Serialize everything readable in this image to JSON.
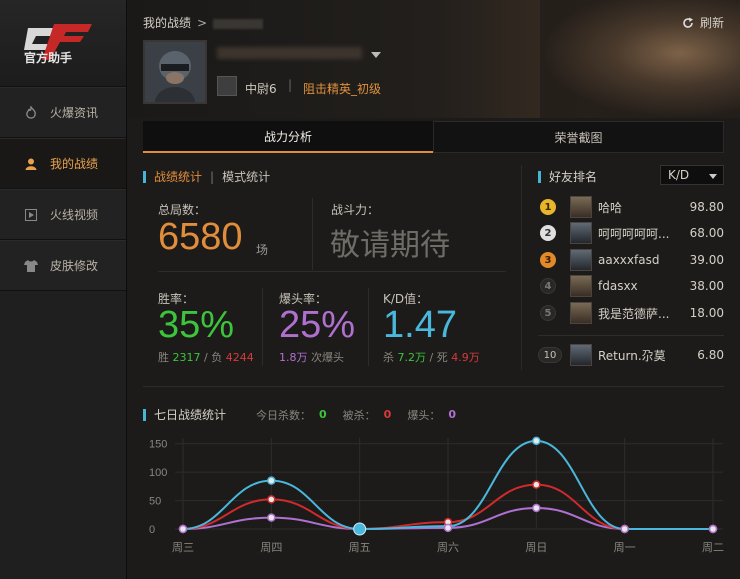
{
  "sidebar": {
    "logo_text": "官方助手",
    "items": [
      {
        "label": "火爆资讯",
        "icon": "flame-icon"
      },
      {
        "label": "我的战绩",
        "icon": "user-icon",
        "active": true
      },
      {
        "label": "火线视频",
        "icon": "play-icon"
      },
      {
        "label": "皮肤修改",
        "icon": "shirt-icon"
      }
    ]
  },
  "header": {
    "breadcrumb_root": "我的战绩",
    "breadcrumb_sep": ">",
    "refresh_label": "刷新",
    "rank": "中尉6",
    "title_badge": "阻击精英_初级"
  },
  "tabs": [
    "战力分析",
    "荣誉截图"
  ],
  "stats": {
    "tab_active": "战绩统计",
    "tab_divider": "|",
    "tab_other": "模式统计",
    "total_label": "总局数：",
    "total_value": "6580",
    "total_unit": "场",
    "power_label": "战斗力：",
    "power_value": "敬请期待",
    "win_label": "胜率：",
    "win_value": "35%",
    "win_prefix": "胜",
    "win_count": "2317",
    "loss_prefix": " / 负",
    "loss_count": "4244",
    "hs_label": "爆头率：",
    "hs_value": "25%",
    "hs_count": "1.8万",
    "hs_suffix": " 次爆头",
    "kd_label": "K/D值：",
    "kd_value": "1.47",
    "kill_prefix": "杀",
    "kill_count": "7.2万",
    "death_prefix": " / 死",
    "death_count": "4.9万"
  },
  "friends": {
    "title": "好友排名",
    "sort_option": "K/D",
    "list": [
      {
        "rank": "1",
        "name": "哈哈",
        "value": "98.80"
      },
      {
        "rank": "2",
        "name": "呵呵呵呵呵...",
        "value": "68.00"
      },
      {
        "rank": "3",
        "name": "aaxxxfasd",
        "value": "39.00"
      },
      {
        "rank": "4",
        "name": "fdasxx",
        "value": "38.00"
      },
      {
        "rank": "5",
        "name": "我是范德萨...",
        "value": "18.00"
      }
    ],
    "self": {
      "rank": "10",
      "name": "Return.尕莫",
      "value": "6.80"
    }
  },
  "seven_day": {
    "title": "七日战绩统计",
    "today_kills_label": "今日杀数：",
    "today_kills": "0",
    "killed_label": "被杀：",
    "killed": "0",
    "headshot_label": "爆头：",
    "headshot": "0"
  },
  "chart_data": {
    "type": "line",
    "categories": [
      "周三",
      "周四",
      "周五",
      "周六",
      "周日",
      "周一",
      "周二"
    ],
    "y_ticks": [
      "0",
      "50",
      "100",
      "150"
    ],
    "ylim": [
      0,
      160
    ],
    "grid": true,
    "series": [
      {
        "color": "#4ab8dc",
        "values": [
          0,
          85,
          0,
          5,
          155,
          0,
          0
        ]
      },
      {
        "color": "#d02a2a",
        "values": [
          0,
          52,
          0,
          12,
          78,
          0,
          0
        ]
      },
      {
        "color": "#b070d0",
        "values": [
          0,
          20,
          0,
          2,
          37,
          0,
          0
        ]
      }
    ]
  }
}
